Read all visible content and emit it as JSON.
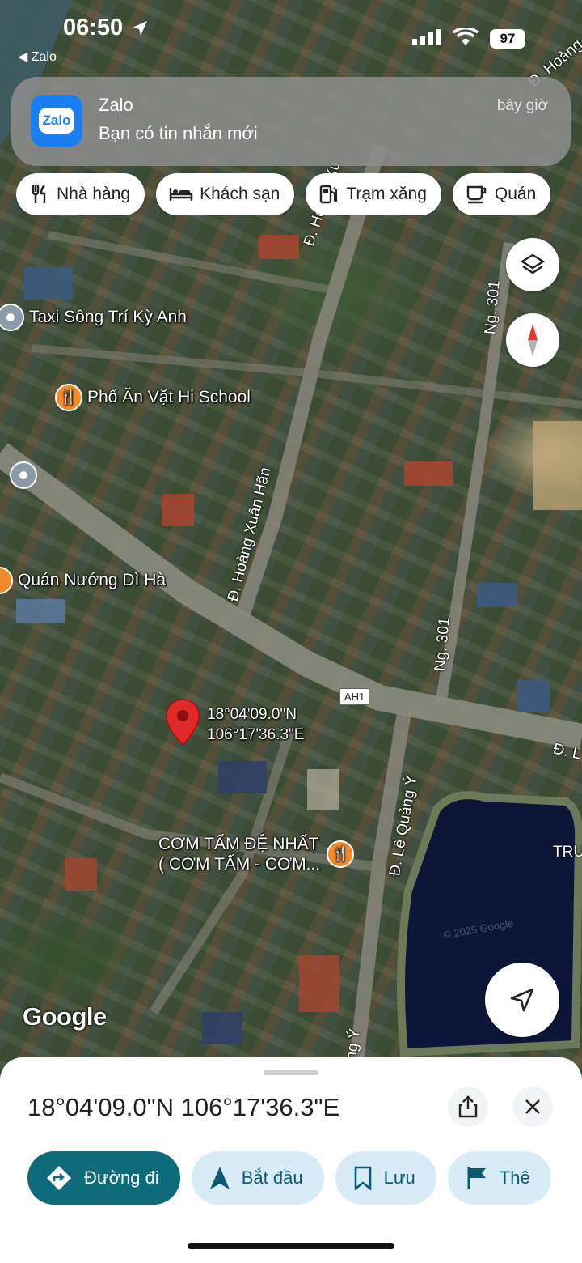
{
  "status_bar": {
    "time": "06:50",
    "back_app": "◀ Zalo",
    "battery": "97"
  },
  "notification": {
    "app": "Zalo",
    "icon_text": "Zalo",
    "message": "Bạn có tin nhắn mới",
    "time": "bây giờ"
  },
  "categories": [
    {
      "label": "Nhà hàng",
      "icon": "utensils-icon"
    },
    {
      "label": "Khách sạn",
      "icon": "bed-icon"
    },
    {
      "label": "Trạm xăng",
      "icon": "gas-station-icon"
    },
    {
      "label": "Quán",
      "icon": "coffee-icon"
    }
  ],
  "map": {
    "pois": [
      {
        "label": "Taxi Sông Trí Kỳ Anh",
        "type": "gray"
      },
      {
        "label": "Phố Ăn Vặt Hi School",
        "type": "orange"
      },
      {
        "label": "Quán Nướng Dì Hà",
        "type": "orange"
      },
      {
        "label_line1": "CƠM TẤM ĐỆ NHẤT",
        "label_line2": "( CƠM TẤM - CƠM..."
      }
    ],
    "roads": {
      "hoang_xuan_han_top": "Đ. Hoàng Xu",
      "hoang_xuan_han": "Đ. Hoàng Xuân Hãn",
      "ng301_top": "Ng. 301",
      "ng301_bottom": "Ng. 301",
      "le_quang_y": "Đ. Lê Quảng Ý",
      "le_quang_y_bottom": "ng Ý",
      "hoang_top_right": "Đ. Hoàng",
      "d_right": "Đ. L",
      "tru": "TRU"
    },
    "route_shield": "AH1",
    "marker_lat": "18°04'09.0\"N",
    "marker_lon": "106°17'36.3\"E",
    "attribution": "Google",
    "watermark": "© 2025 Google"
  },
  "sheet": {
    "title": "18°04'09.0\"N 106°17'36.3\"E",
    "actions": [
      {
        "label": "Đường đi",
        "icon": "directions-icon"
      },
      {
        "label": "Bắt đầu",
        "icon": "navigation-arrow-icon"
      },
      {
        "label": "Lưu",
        "icon": "bookmark-icon"
      },
      {
        "label": "Thê",
        "icon": "flag-icon"
      }
    ]
  },
  "colors": {
    "primary_action": "#0e6b7a",
    "secondary_action": "#d8ecf7",
    "marker": "#e02a2a",
    "poi_orange": "#f08a2a"
  }
}
